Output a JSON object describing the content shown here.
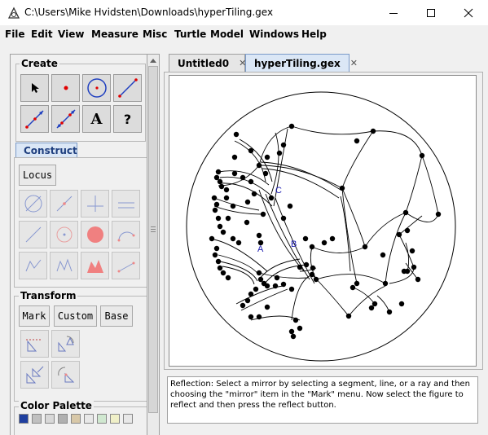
{
  "window": {
    "title": "C:\\Users\\Mike Hvidsten\\Downloads\\hyperTiling.gex"
  },
  "menu": [
    "File",
    "Edit",
    "View",
    "Measure",
    "Misc",
    "Turtle",
    "Model",
    "Windows",
    "Help"
  ],
  "left_panel": {
    "create_title": "Create",
    "create_tools": [
      "pointer-tool",
      "point-tool",
      "circle-tool",
      "segment-tool",
      "ray-tool",
      "line-tool",
      "text-tool",
      "help-tool"
    ],
    "create_text_label": "A",
    "create_help_label": "?",
    "construct_tab": "Construct",
    "locus_button": "Locus",
    "transform_title": "Transform",
    "transform_buttons": [
      "Mark",
      "Custom",
      "Base"
    ],
    "color_palette_title": "Color Palette",
    "palette_colors": [
      "#1f3f9f",
      "#c0c0c0",
      "#d8d8d8",
      "#b0b0b0",
      "#d8c8a8",
      "#e8e8e8",
      "#d0e8d0",
      "#f0f0c8",
      "#e8e8e8"
    ]
  },
  "tabs": [
    {
      "label": "Untitled0",
      "active": false
    },
    {
      "label": "hyperTiling.gex",
      "active": true
    }
  ],
  "canvas": {
    "labels": {
      "A": "A",
      "B": "B",
      "C": "C"
    },
    "label_color": "#1a1ab0"
  },
  "status": {
    "message": "Reflection: Select a mirror by selecting a segment, line, or a ray and then choosing the \"mirror\" item in the \"Mark\" menu. Now select the figure to reflect and then press the reflect button."
  }
}
